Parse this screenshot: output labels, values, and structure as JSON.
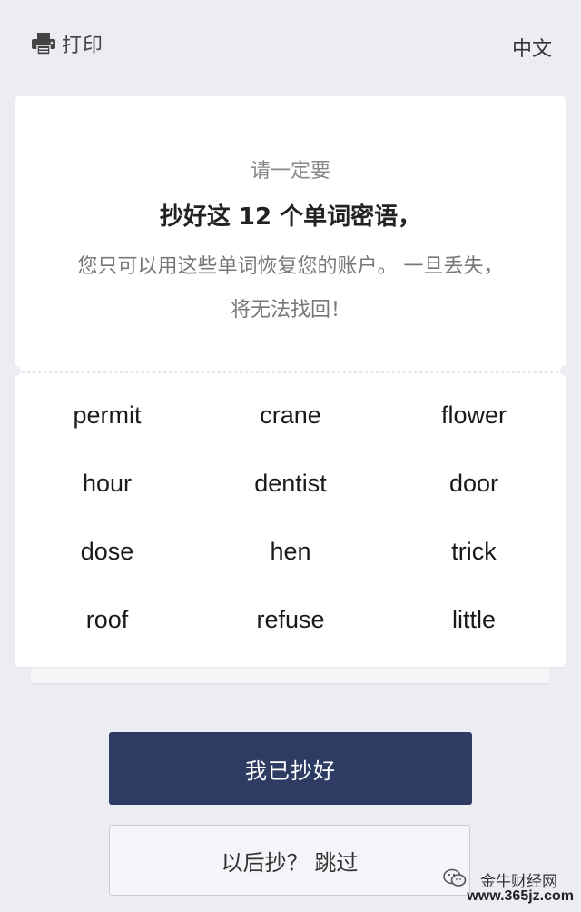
{
  "topbar": {
    "print_label": "打印",
    "print_icon": "printer-icon",
    "language_label": "中文"
  },
  "card": {
    "intro": "请一定要",
    "headline": "抄好这 12 个单词密语，",
    "description": "您只可以用这些单词恢复您的账户。 一旦丢失，将无法找回！"
  },
  "words": [
    "permit",
    "crane",
    "flower",
    "hour",
    "dentist",
    "door",
    "dose",
    "hen",
    "trick",
    "roof",
    "refuse",
    "little"
  ],
  "actions": {
    "confirm_label": "我已抄好",
    "skip_label": "以后抄？ 跳过"
  },
  "watermark": {
    "name": "金牛财经网",
    "url": "www.365jz.com",
    "icon": "wechat-icon"
  },
  "colors": {
    "background": "#ecedf3",
    "primary_button": "#2e3c63",
    "card": "#ffffff"
  }
}
